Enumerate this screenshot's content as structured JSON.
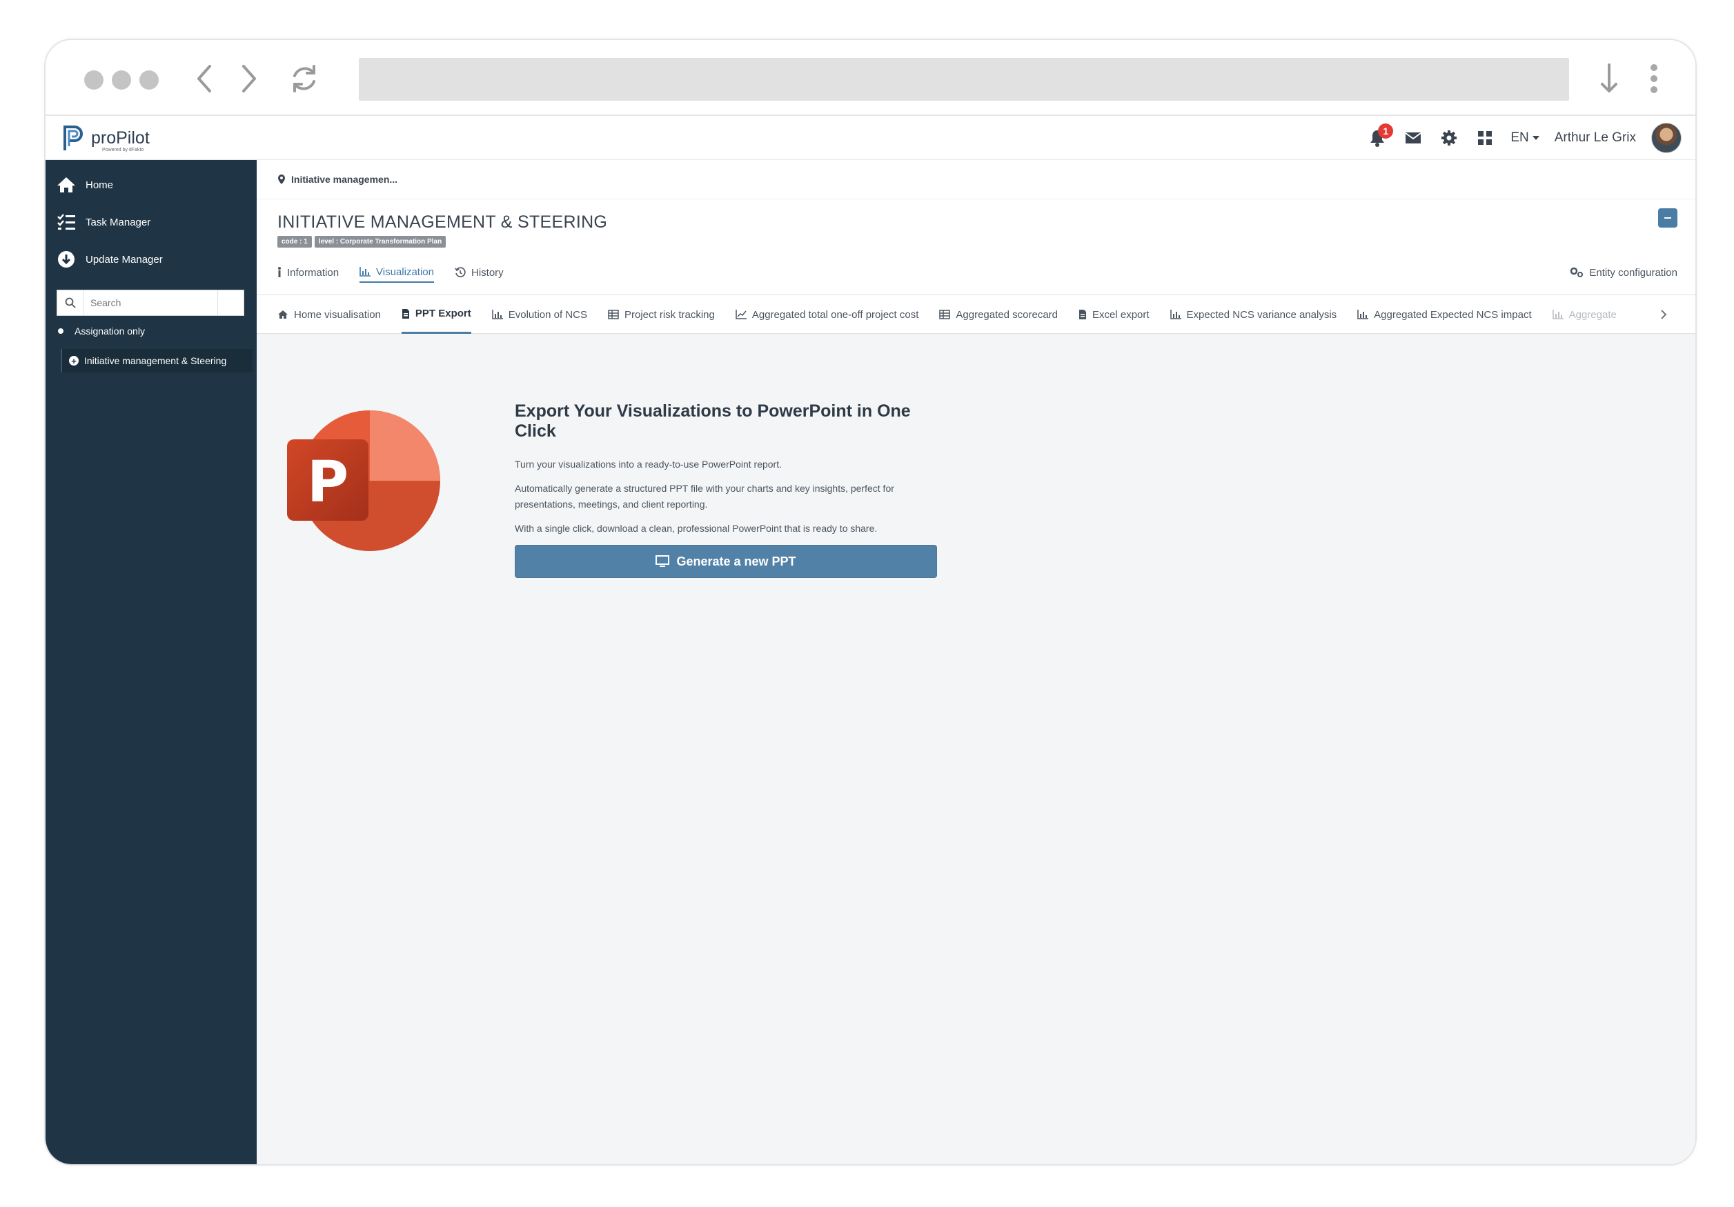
{
  "app": {
    "name": "proPilot",
    "powered_by": "Powered by dFakto"
  },
  "topbar": {
    "notification_count": "1",
    "language": "EN",
    "user_name": "Arthur Le Grix"
  },
  "sidebar": {
    "items": [
      {
        "label": "Home",
        "icon": "home-icon"
      },
      {
        "label": "Task Manager",
        "icon": "tasks-icon"
      },
      {
        "label": "Update Manager",
        "icon": "download-circle-icon"
      }
    ],
    "search_placeholder": "Search",
    "assignation_label": "Assignation only",
    "tree_item": "Initiative management & Steering"
  },
  "header": {
    "breadcrumb": "Initiative managemen...",
    "title": "INITIATIVE MANAGEMENT & STEERING",
    "tags": [
      "code : 1",
      "level : Corporate Transformation Plan"
    ],
    "tabs": [
      {
        "label": "Information",
        "icon": "info-icon"
      },
      {
        "label": "Visualization",
        "icon": "chart-icon"
      },
      {
        "label": "History",
        "icon": "history-icon"
      }
    ],
    "entity_config": "Entity configuration"
  },
  "subtabs": [
    {
      "label": "Home visualisation",
      "icon": "home-icon"
    },
    {
      "label": "PPT Export",
      "icon": "file-icon"
    },
    {
      "label": "Evolution of NCS",
      "icon": "chart-icon"
    },
    {
      "label": "Project risk tracking",
      "icon": "table-icon"
    },
    {
      "label": "Aggregated total one-off project cost",
      "icon": "line-chart-icon"
    },
    {
      "label": "Aggregated scorecard",
      "icon": "table-icon"
    },
    {
      "label": "Excel export",
      "icon": "file-icon"
    },
    {
      "label": "Expected NCS variance analysis",
      "icon": "chart-icon"
    },
    {
      "label": "Aggregated Expected NCS impact",
      "icon": "chart-icon"
    },
    {
      "label": "Aggregate",
      "icon": "chart-icon"
    }
  ],
  "content": {
    "title": "Export Your Visualizations to PowerPoint in One Click",
    "p1": "Turn your visualizations into a ready-to-use PowerPoint report.",
    "p2": "Automatically generate a structured PPT file with your charts and key insights, perfect for presentations, meetings, and client reporting.",
    "p3": "With a single click, download a clean, professional PowerPoint that is ready to share.",
    "button": "Generate a new PPT",
    "logo_letter": "P"
  },
  "colors": {
    "sidebar": "#1f3444",
    "accent": "#4a7ca4",
    "button": "#5281a7",
    "badge": "#e53935"
  }
}
